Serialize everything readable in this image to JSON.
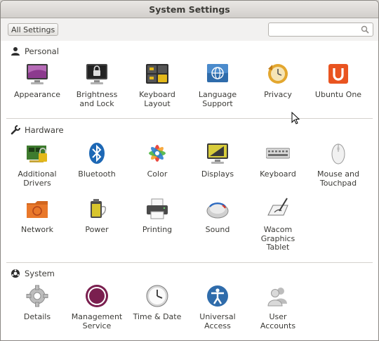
{
  "window": {
    "title": "System Settings"
  },
  "toolbar": {
    "all_settings_label": "All Settings",
    "search_placeholder": ""
  },
  "sections": {
    "personal": {
      "title": "Personal",
      "items": [
        "Appearance",
        "Brightness\nand Lock",
        "Keyboard\nLayout",
        "Language\nSupport",
        "Privacy",
        "Ubuntu One"
      ]
    },
    "hardware": {
      "title": "Hardware",
      "items": [
        "Additional\nDrivers",
        "Bluetooth",
        "Color",
        "Displays",
        "Keyboard",
        "Mouse and\nTouchpad",
        "Network",
        "Power",
        "Printing",
        "Sound",
        "Wacom\nGraphics\nTablet"
      ]
    },
    "system": {
      "title": "System",
      "items": [
        "Details",
        "Management\nService",
        "Time & Date",
        "Universal\nAccess",
        "User\nAccounts"
      ]
    }
  },
  "colors": {
    "ubuntu_orange": "#e95420",
    "management_purple": "#7a1f4f",
    "bluetooth_blue": "#1d68b5"
  }
}
